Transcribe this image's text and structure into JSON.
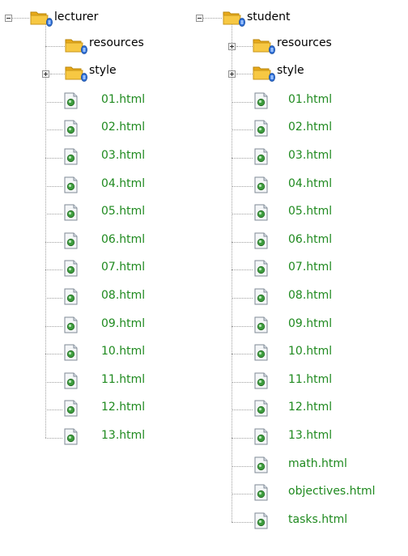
{
  "left_tree": {
    "root": "lecturer",
    "children": [
      {
        "type": "folder",
        "name": "resources",
        "expanded": false,
        "has_expander": false
      },
      {
        "type": "folder",
        "name": "style",
        "expanded": false,
        "has_expander": true
      },
      {
        "type": "file",
        "name": "01.html"
      },
      {
        "type": "file",
        "name": "02.html"
      },
      {
        "type": "file",
        "name": "03.html"
      },
      {
        "type": "file",
        "name": "04.html"
      },
      {
        "type": "file",
        "name": "05.html"
      },
      {
        "type": "file",
        "name": "06.html"
      },
      {
        "type": "file",
        "name": "07.html"
      },
      {
        "type": "file",
        "name": "08.html"
      },
      {
        "type": "file",
        "name": "09.html"
      },
      {
        "type": "file",
        "name": "10.html"
      },
      {
        "type": "file",
        "name": "11.html"
      },
      {
        "type": "file",
        "name": "12.html"
      },
      {
        "type": "file",
        "name": "13.html"
      }
    ]
  },
  "right_tree": {
    "root": "student",
    "children": [
      {
        "type": "folder",
        "name": "resources",
        "expanded": false,
        "has_expander": true
      },
      {
        "type": "folder",
        "name": "style",
        "expanded": false,
        "has_expander": true
      },
      {
        "type": "file",
        "name": "01.html"
      },
      {
        "type": "file",
        "name": "02.html"
      },
      {
        "type": "file",
        "name": "03.html"
      },
      {
        "type": "file",
        "name": "04.html"
      },
      {
        "type": "file",
        "name": "05.html"
      },
      {
        "type": "file",
        "name": "06.html"
      },
      {
        "type": "file",
        "name": "07.html"
      },
      {
        "type": "file",
        "name": "08.html"
      },
      {
        "type": "file",
        "name": "09.html"
      },
      {
        "type": "file",
        "name": "10.html"
      },
      {
        "type": "file",
        "name": "11.html"
      },
      {
        "type": "file",
        "name": "12.html"
      },
      {
        "type": "file",
        "name": "13.html"
      },
      {
        "type": "file",
        "name": "math.html"
      },
      {
        "type": "file",
        "name": "objectives.html"
      },
      {
        "type": "file",
        "name": "tasks.html"
      }
    ]
  },
  "colors": {
    "file_label": "#1f8a1f",
    "folder_label": "#000000",
    "tree_lines": "#a0a0a0",
    "folder_fill": "#f5c33b",
    "badge_blue": "#2f6fd6"
  },
  "icons": {
    "folder": "folder-icon",
    "badge": "svn-badge-icon",
    "file": "html-file-icon",
    "expander_expanded": "minus-expander-icon",
    "expander_collapsed": "plus-expander-icon"
  }
}
